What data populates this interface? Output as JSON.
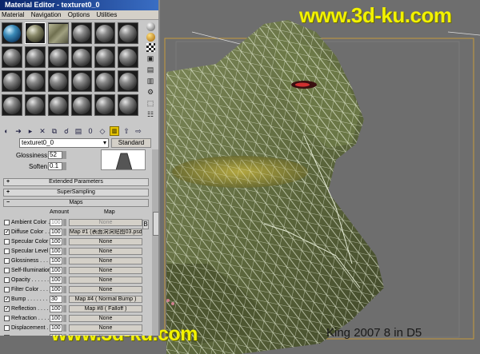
{
  "watermark": {
    "top": "www.3d-ku.com",
    "bottom": "www.3d-ku.com"
  },
  "credit": "King  2007 8 in D5",
  "material_editor": {
    "title": "Material Editor - texturet0_0",
    "menu": [
      "Material",
      "Navigation",
      "Options",
      "Utilities"
    ],
    "side_toolbar_icons": [
      "sample-type-sphere-icon",
      "backlight-icon",
      "background-checker-icon",
      "sample-uv-tiling-icon",
      "video-color-check-icon",
      "make-preview-icon",
      "options-icon",
      "select-by-material-icon",
      "material-map-navigator-icon"
    ],
    "toolbar_icons": [
      "get-material-icon",
      "put-to-scene-icon",
      "assign-to-selection-icon",
      "reset-map-icon",
      "make-copy-icon",
      "make-unique-icon",
      "put-to-library-icon",
      "material-id-channel-icon",
      "show-map-in-viewport-icon",
      "show-end-result-icon",
      "go-to-parent-icon",
      "go-forward-to-sibling-icon"
    ],
    "material_name": "texturet0_0",
    "material_type": "Standard",
    "glossiness": {
      "label": "Glossiness:",
      "value": "52"
    },
    "soften": {
      "label": "Soften:",
      "value": "0.1"
    },
    "rollouts": {
      "extended": "Extended Parameters",
      "supersampling": "SuperSampling",
      "maps": "Maps"
    },
    "maps_headers": {
      "amount": "Amount",
      "map": "Map"
    },
    "maps": [
      {
        "label": "Ambient Color . . . .",
        "checked": false,
        "amount": "100",
        "map": "None",
        "dim": true
      },
      {
        "label": "Diffuse Color . . . .",
        "checked": true,
        "amount": "100",
        "map": "Map #1 (表面洞洞贴图03.psd)",
        "dim": false
      },
      {
        "label": "Specular Color . . .",
        "checked": false,
        "amount": "100",
        "map": "None",
        "dim": false
      },
      {
        "label": "Specular Level . . .",
        "checked": false,
        "amount": "100",
        "map": "None",
        "dim": false
      },
      {
        "label": "Glossiness . . . . .",
        "checked": false,
        "amount": "100",
        "map": "None",
        "dim": false
      },
      {
        "label": "Self-Illumination . .",
        "checked": false,
        "amount": "100",
        "map": "None",
        "dim": false
      },
      {
        "label": "Opacity . . . . . . .",
        "checked": false,
        "amount": "100",
        "map": "None",
        "dim": false
      },
      {
        "label": "Filter Color . . . .",
        "checked": false,
        "amount": "100",
        "map": "None",
        "dim": false
      },
      {
        "label": "Bump . . . . . . . .",
        "checked": true,
        "amount": "30",
        "map": "Map #4  ( Normal Bump )",
        "dim": false
      },
      {
        "label": "Reflection . . . . .",
        "checked": true,
        "amount": "100",
        "map": "Map #8  ( Falloff )",
        "dim": false
      },
      {
        "label": "Refraction . . . . .",
        "checked": false,
        "amount": "100",
        "map": "None",
        "dim": false
      },
      {
        "label": "Displacement . . . .",
        "checked": false,
        "amount": "100",
        "map": "None",
        "dim": false
      },
      {
        "label": " ",
        "checked": false,
        "amount": "100",
        "map": "None",
        "dim": true
      }
    ],
    "side_tag": "B"
  }
}
